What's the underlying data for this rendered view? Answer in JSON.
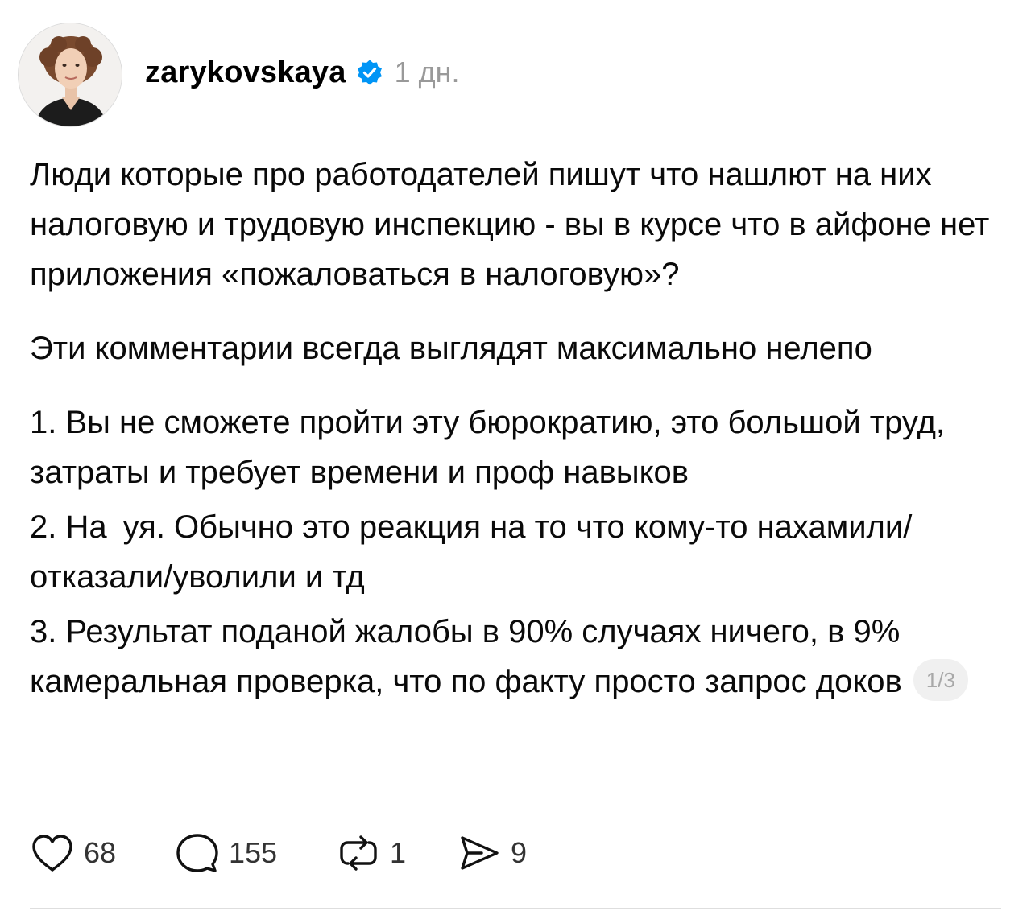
{
  "post": {
    "username": "zarykovskaya",
    "time": "1 дн.",
    "paragraphs": [
      "Люди которые про работодателей пишут что нашлют на них налоговую и трудовую инспекцию - вы в курсе что в айфоне нет приложения «пожаловаться в налоговую»?",
      "Эти комментарии всегда выглядят максимально нелепо",
      "1. Вы не сможете пройти эту бюрократию, это большой труд, затраты и требует времени и проф навыков"
    ],
    "item2_before": "2. На",
    "item2_after": "уя. Обычно это реакция на то что кому-то нахамили/отказали/уволили и тд",
    "item3": "3. Результат поданой жалобы в 90% случаях ничего, в 9% камеральная проверка, что по факту просто запрос доков",
    "pager": "1/3"
  },
  "actions": {
    "likes": "68",
    "comments": "155",
    "reposts": "1",
    "shares": "9"
  },
  "icons": {
    "like": "heart-icon",
    "comment": "comment-bubble-icon",
    "repost": "repost-icon",
    "share": "send-icon",
    "verified": "verified-badge-icon"
  },
  "colors": {
    "verified": "#0095f6",
    "muted_text": "#999999",
    "pager_bg": "#f0f0f0"
  }
}
